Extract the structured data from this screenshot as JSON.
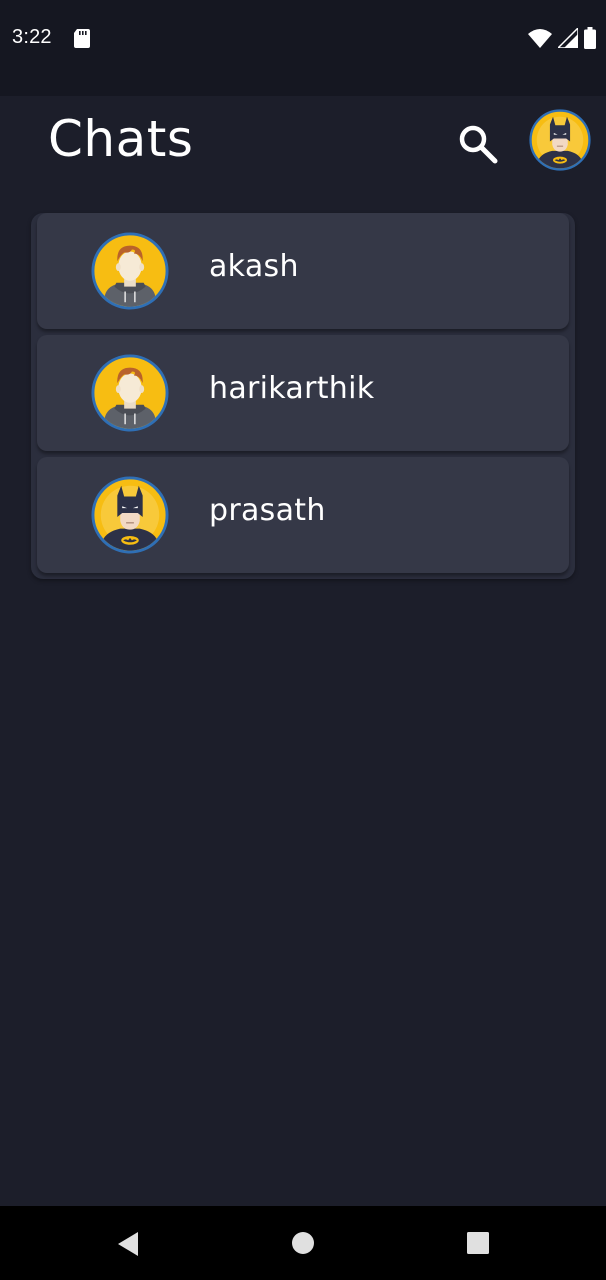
{
  "status_bar": {
    "time": "3:22",
    "icons": [
      "sd-card-icon",
      "wifi-icon",
      "cellular-signal-icon",
      "battery-icon"
    ]
  },
  "app_bar": {
    "title": "Chats",
    "search_icon": "search-icon",
    "profile_avatar": "batman-avatar"
  },
  "chats": [
    {
      "name": "akash",
      "avatar": "male-hoodie-avatar"
    },
    {
      "name": "harikarthik",
      "avatar": "male-hoodie-avatar"
    },
    {
      "name": "prasath",
      "avatar": "batman-avatar"
    }
  ],
  "nav_bar": {
    "icons": [
      "back-icon",
      "home-icon",
      "recents-icon"
    ]
  },
  "colors": {
    "background": "#1c1e2a",
    "status_bar": "#151721",
    "card": "#2b2e3d",
    "row": "#353847",
    "avatar_yellow": "#f7bd12",
    "avatar_ring": "#2f6fb5",
    "text": "#ffffff"
  }
}
